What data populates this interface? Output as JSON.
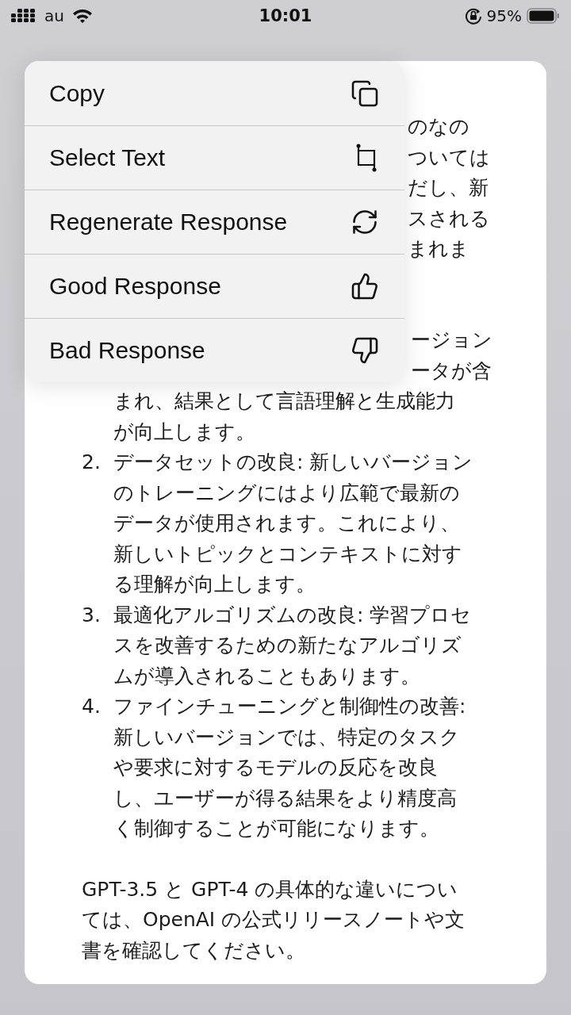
{
  "status_bar": {
    "carrier": "au",
    "time": "10:01",
    "battery": "95%"
  },
  "menu": [
    {
      "label": "Copy",
      "kind": "copy"
    },
    {
      "label": "Select Text",
      "kind": "select"
    },
    {
      "label": "Regenerate Response",
      "kind": "regenerate"
    },
    {
      "label": "Good Response",
      "kind": "good"
    },
    {
      "label": "Bad Response",
      "kind": "bad"
    }
  ],
  "response": {
    "covered_lines": [
      "のなの",
      "ついては",
      "だし、新",
      "スされる",
      "まれま"
    ],
    "list": [
      {
        "covered_lines": [
          "ージョン",
          "ータが含"
        ],
        "lines": [
          "まれ、結果として言語理解と生成能力",
          "が向上します。"
        ]
      },
      {
        "number": "2.",
        "lines": [
          "データセットの改良: 新しいバージョン",
          "のトレーニングにはより広範で最新の",
          "データが使用されます。これにより、",
          "新しいトピックとコンテキストに対す",
          "る理解が向上します。"
        ]
      },
      {
        "number": "3.",
        "lines": [
          "最適化アルゴリズムの改良: 学習プロセ",
          "スを改善するための新たなアルゴリズ",
          "ムが導入されることもあります。"
        ]
      },
      {
        "number": "4.",
        "lines": [
          "ファインチューニングと制御性の改善:",
          "新しいバージョンでは、特定のタスク",
          "や要求に対するモデルの反応を改良",
          "し、ユーザーが得る結果をより精度高",
          "く制御することが可能になります。"
        ]
      }
    ],
    "closing": [
      "GPT-3.5 と GPT-4 の具体的な違いについ",
      "ては、OpenAI の公式リリースノートや文",
      "書を確認してください。"
    ]
  }
}
